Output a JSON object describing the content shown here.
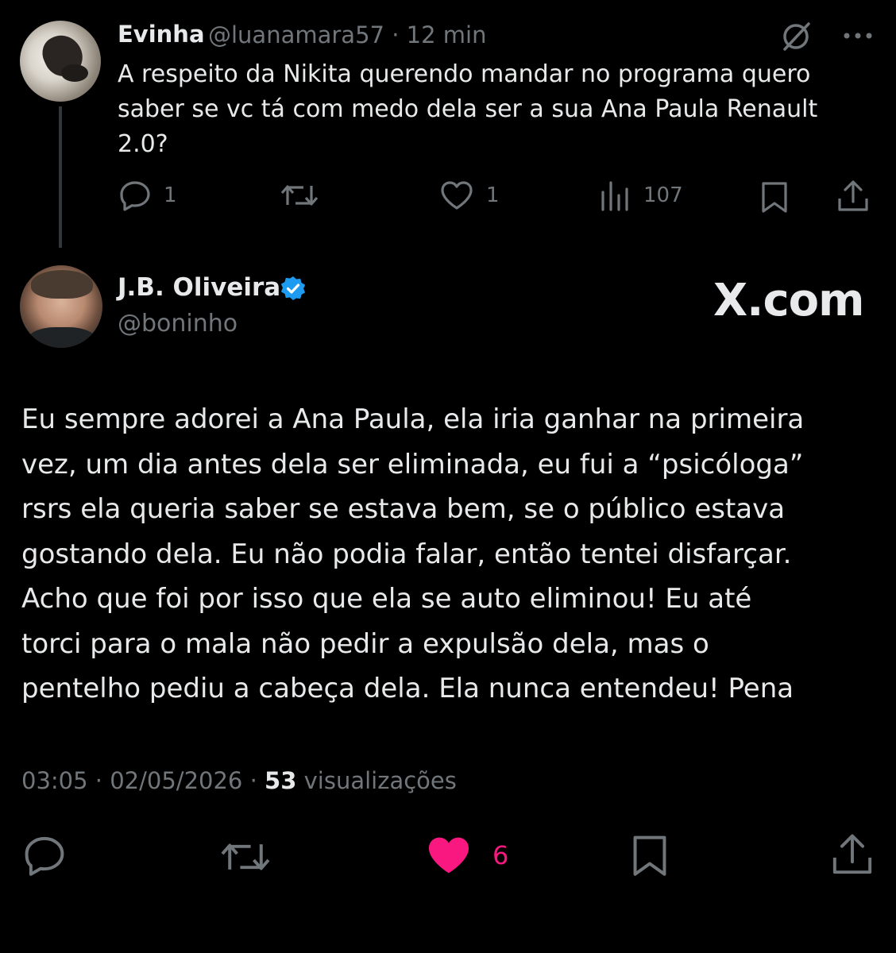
{
  "reply": {
    "display_name": "Evinha",
    "handle": "@luanamara57",
    "separator": "·",
    "time_ago": "12 min",
    "text": "A respeito da Nikita querendo mandar no programa quero saber se vc tá com medo dela ser a sua Ana Paula Renault 2.0?",
    "actions": {
      "replies": "1",
      "reposts": "",
      "likes": "1",
      "views": "107"
    }
  },
  "tweet": {
    "display_name": "J.B. Oliveira",
    "handle": "@boninho",
    "watermark": "X.com",
    "text_lines": [
      "Eu sempre adorei a Ana Paula, ela iria ganhar na primeira",
      "vez, um dia antes dela ser eliminada, eu fui a “psicóloga”",
      "rsrs ela queria saber se estava bem, se o público estava",
      "gostando dela. Eu não podia falar, então tentei disfarçar.",
      "Acho que foi por isso que ela se auto eliminou! Eu até",
      "torci para o mala não pedir a expulsão dela, mas o",
      "pentelho pediu a cabeça dela. Ela nunca entendeu! Pena"
    ],
    "time": "03:05",
    "date": "02/05/2026",
    "separator": "·",
    "views_count": "53",
    "views_label": "visualizações",
    "actions": {
      "likes": "6"
    }
  },
  "colors": {
    "background": "#000000",
    "text": "#e7e9ea",
    "muted": "#71767b",
    "like_active": "#f91880",
    "verified": "#1d9bf0"
  },
  "icons": {
    "reply": "comment-icon",
    "repost": "repost-icon",
    "like": "heart-icon",
    "views": "views-icon",
    "bookmark": "bookmark-icon",
    "share": "share-icon",
    "grok": "grok-icon",
    "more": "more-icon",
    "verified": "verified-badge-icon"
  }
}
